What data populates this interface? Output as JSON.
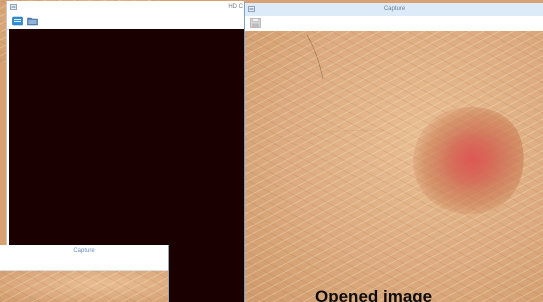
{
  "windows": {
    "hd_camera": {
      "title": "HD C"
    },
    "capture_main": {
      "title": "Capture"
    },
    "capture_small": {
      "title": "Capture"
    }
  },
  "main_image": {
    "caption": "Opened image"
  },
  "colors": {
    "video_background": "#1a0000",
    "skin_tone": "#dcaa7e",
    "lesion": "#d75f50",
    "capture_titlebar": "#ddeaf7"
  },
  "icons": [
    "app-icon",
    "camera-icon",
    "folder-icon",
    "save-icon"
  ]
}
